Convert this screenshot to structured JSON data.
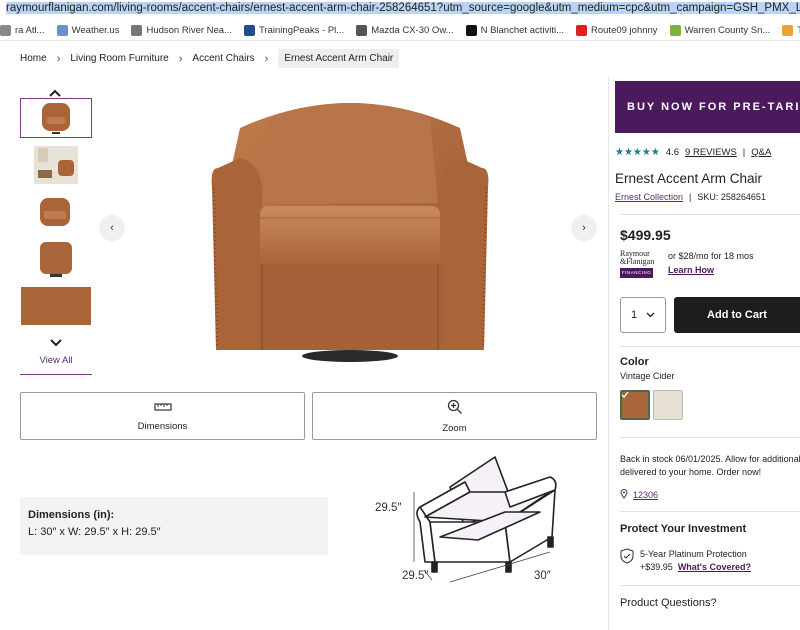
{
  "browser": {
    "url": "raymourflanigan.com/living-rooms/accent-chairs/ernest-accent-arm-chair-258264651?utm_source=google&utm_medium=cpc&utm_campaign=GSH_PMX_Living+Room&utm_term=&gad_sour",
    "bookmarks": [
      {
        "label": "ra Atl...",
        "icon": "globe-icon",
        "color": "#888888"
      },
      {
        "label": "Weather.us",
        "icon": "weather-icon",
        "color": "#6a8fd1"
      },
      {
        "label": "Hudson River Nea...",
        "icon": "bookmark-icon",
        "color": "#777777"
      },
      {
        "label": "TrainingPeaks - Pl...",
        "icon": "trainingpeaks-icon",
        "color": "#1f4e8c"
      },
      {
        "label": "Mazda CX-30 Ow...",
        "icon": "mazda-icon",
        "color": "#555555"
      },
      {
        "label": "N Blanchet activiti...",
        "icon": "strava-icon",
        "color": "#111111"
      },
      {
        "label": "Route09 johnny",
        "icon": "youtube-icon",
        "color": "#e02020"
      },
      {
        "label": "Warren County Sn...",
        "icon": "bookmark-icon",
        "color": "#7bb33b"
      },
      {
        "label": "Ticks in Warren C...",
        "icon": "bookmark-icon",
        "color": "#e8a23a"
      }
    ]
  },
  "breadcrumb": {
    "items": [
      "Home",
      "Living Room Furniture",
      "Accent Chairs"
    ],
    "current": "Ernest Accent Arm Chair"
  },
  "gallery": {
    "view_all": "View All"
  },
  "actions": {
    "dimensions": "Dimensions",
    "zoom": "Zoom"
  },
  "dimensions": {
    "title": "Dimensions (in):",
    "value": "L: 30″ x W: 29.5″ x H: 29.5″",
    "diagram_height": "29.5″",
    "diagram_depth": "29.5″",
    "diagram_width": "30″"
  },
  "promo": {
    "banner": "BUY NOW FOR PRE-TARIFF PRICES"
  },
  "product": {
    "rating": "4.6",
    "stars": 4.6,
    "reviews": "9 REVIEWS",
    "qa": "Q&A",
    "title": "Ernest Accent Arm Chair",
    "collection": "Ernest Collection",
    "sku": "SKU: 258264651",
    "price": "$499.95",
    "financing_logo_top": "Raymour",
    "financing_logo_bottom": "&Flanigan",
    "financing_badge": "FINANCING",
    "financing_text": "or $28/mo for 18 mos",
    "learn_how": "Learn How",
    "quantity": "1",
    "add_to_cart": "Add to Cart",
    "color_label": "Color",
    "color_value": "Vintage Cider",
    "stock_line1": "Back in stock 06/01/2025. Allow for additional",
    "stock_line2": "delivered to your home. Order now!",
    "zip": "12306",
    "protect_title": "Protect Your Investment",
    "plan_name": "5-Year Platinum Protection",
    "plan_price": "+$39.95",
    "whats_covered": "What's Covered?",
    "questions": "Product Questions?"
  },
  "colors": {
    "accent": "#4a1a5c",
    "leather": "#b06a3e",
    "cart": "#1d1d1d",
    "stars": "#1a7f86"
  }
}
